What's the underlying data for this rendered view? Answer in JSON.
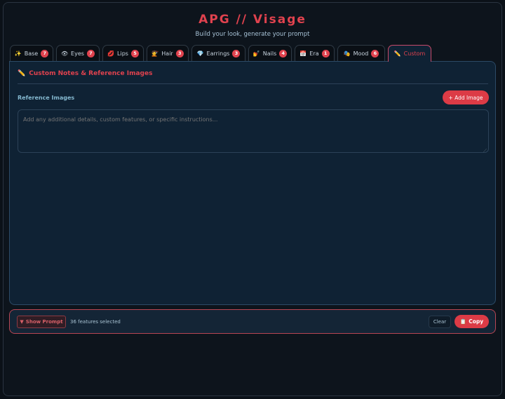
{
  "app": {
    "title": "APG // Visage",
    "subtitle": "Build your look, generate your prompt"
  },
  "tabs": [
    {
      "label": "Base",
      "count": "7",
      "icon": "sparkles-icon",
      "glyph": "✨"
    },
    {
      "label": "Eyes",
      "count": "7",
      "icon": "eye-icon",
      "glyph": "👁"
    },
    {
      "label": "Lips",
      "count": "5",
      "icon": "lips-icon",
      "glyph": "💋"
    },
    {
      "label": "Hair",
      "count": "3",
      "icon": "hair-icon",
      "glyph": "💇"
    },
    {
      "label": "Earrings",
      "count": "3",
      "icon": "gem-icon",
      "glyph": "💎"
    },
    {
      "label": "Nails",
      "count": "4",
      "icon": "nail-polish-icon",
      "glyph": "💅"
    },
    {
      "label": "Era",
      "count": "1",
      "icon": "calendar-icon",
      "glyph": "📅"
    },
    {
      "label": "Mood",
      "count": "6",
      "icon": "masks-icon",
      "glyph": "🎭"
    },
    {
      "label": "Custom",
      "count": "",
      "icon": "pencil-icon",
      "glyph": "✏️"
    }
  ],
  "panel": {
    "title": "Custom Notes & Reference Images",
    "reference_label": "Reference Images",
    "add_image": "+ Add Image",
    "notes_placeholder": "Add any additional details, custom features, or specific instructions...",
    "notes_value": ""
  },
  "bottom": {
    "show_prompt": "Show Prompt",
    "features_selected": "36 features selected",
    "clear": "Clear",
    "copy": "Copy"
  },
  "colors": {
    "accent": "#dc3b46",
    "background": "#0b1118",
    "panel": "#0f2234"
  }
}
